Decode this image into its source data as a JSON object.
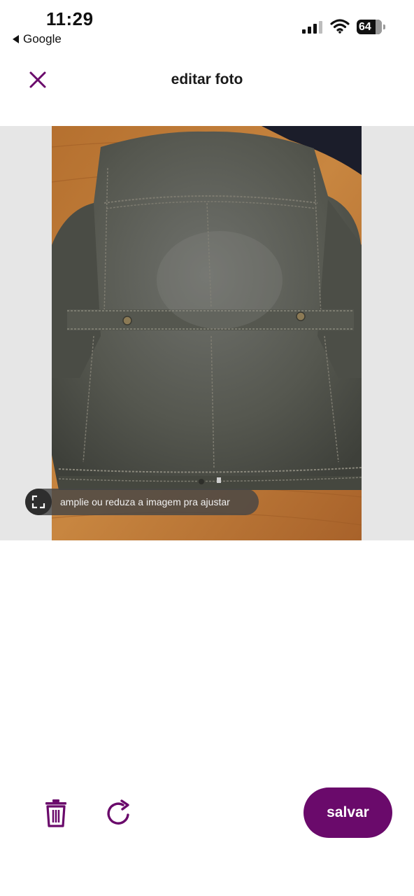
{
  "status_bar": {
    "time": "11:29",
    "back_app": "Google",
    "battery": "64"
  },
  "header": {
    "title": "editar foto",
    "close_icon": "close-icon"
  },
  "photo": {
    "description_icon": "jacket-photo",
    "hint": "amplie ou reduza a imagem pra ajustar",
    "hint_icon": "resize-icon"
  },
  "toolbar": {
    "delete_icon": "trash-icon",
    "rotate_icon": "rotate-icon",
    "save_label": "salvar"
  },
  "colors": {
    "accent": "#6a0a6b",
    "photo_backdrop": "#e6e6e6"
  }
}
